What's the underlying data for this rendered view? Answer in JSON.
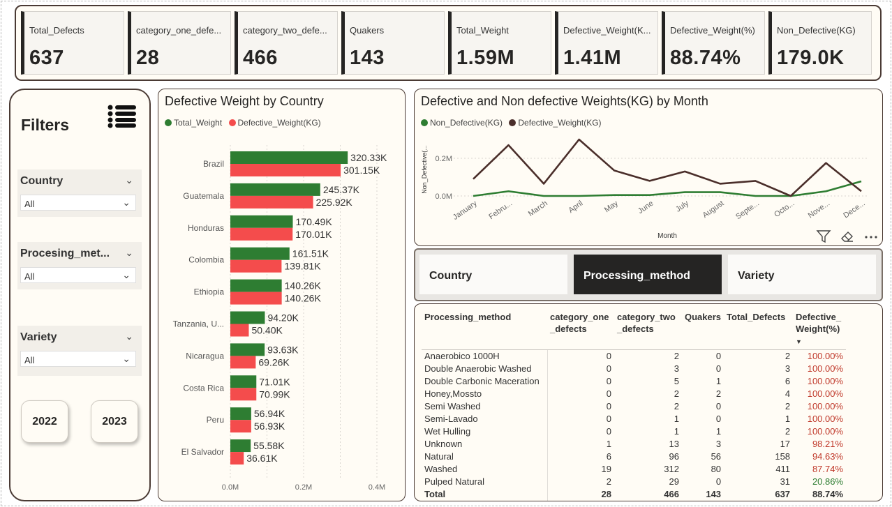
{
  "kpis": [
    {
      "label": "Total_Defects",
      "value": "637"
    },
    {
      "label": "category_one_defe...",
      "value": "28"
    },
    {
      "label": "category_two_defe...",
      "value": "466"
    },
    {
      "label": "Quakers",
      "value": "143"
    },
    {
      "label": "Total_Weight",
      "value": "1.59M"
    },
    {
      "label": "Defective_Weight(K...",
      "value": "1.41M"
    },
    {
      "label": "Defective_Weight(%)",
      "value": "88.74%"
    },
    {
      "label": "Non_Defective(KG)",
      "value": "179.0K"
    }
  ],
  "filters": {
    "title": "Filters",
    "icon": "list-icon",
    "slicers": [
      {
        "label": "Country",
        "value": "All"
      },
      {
        "label": "Procesing_met...",
        "value": "All"
      },
      {
        "label": "Variety",
        "value": "All"
      }
    ],
    "years": [
      "2022",
      "2023"
    ]
  },
  "bar_chart": {
    "title": "Defective Weight by Country",
    "legend": [
      {
        "name": "Total_Weight",
        "color": "#2e7d32"
      },
      {
        "name": "Defective_Weight(KG)",
        "color": "#f44c4c"
      }
    ]
  },
  "line_chart": {
    "title": "Defective and Non defective Weights(KG) by Month",
    "legend": [
      {
        "name": "Non_Defective(KG)",
        "color": "#2e7d32"
      },
      {
        "name": "Defective_Weight(KG)",
        "color": "#4a2e2a"
      }
    ],
    "ylabel": "Non_Defective(...",
    "xlabel": "Month",
    "toolbar_icons": [
      "filter-icon",
      "eraser-icon",
      "more-icon"
    ]
  },
  "chart_data": [
    {
      "type": "bar",
      "title": "Defective Weight by Country",
      "categories": [
        "Brazil",
        "Guatemala",
        "Honduras",
        "Colombia",
        "Ethiopia",
        "Tanzania, U...",
        "Nicaragua",
        "Costa Rica",
        "Peru",
        "El Salvador"
      ],
      "series": [
        {
          "name": "Total_Weight",
          "values": [
            320330,
            245370,
            170490,
            161510,
            140260,
            94200,
            93630,
            71010,
            56940,
            55580
          ],
          "labels": [
            "320.33K",
            "245.37K",
            "170.49K",
            "161.51K",
            "140.26K",
            "94.20K",
            "93.63K",
            "71.01K",
            "56.94K",
            "55.58K"
          ]
        },
        {
          "name": "Defective_Weight(KG)",
          "values": [
            301150,
            225920,
            170010,
            139810,
            140260,
            50400,
            69260,
            70990,
            56930,
            36610
          ],
          "labels": [
            "301.15K",
            "225.92K",
            "170.01K",
            "139.81K",
            "140.26K",
            "50.40K",
            "69.26K",
            "70.99K",
            "56.93K",
            "36.61K"
          ]
        }
      ],
      "xlim": [
        0,
        400000
      ],
      "xticks": [
        "0.0M",
        "0.2M",
        "0.4M"
      ],
      "orientation": "horizontal",
      "grid": true,
      "legend_position": "top-left"
    },
    {
      "type": "line",
      "title": "Defective and Non defective Weights(KG) by Month",
      "x": [
        "January",
        "Febru...",
        "March",
        "April",
        "May",
        "June",
        "July",
        "August",
        "Septe...",
        "Octo...",
        "Nove...",
        "Dece..."
      ],
      "series": [
        {
          "name": "Non_Defective(KG)",
          "values": [
            0,
            25000,
            0,
            0,
            5000,
            5000,
            20000,
            20000,
            0,
            0,
            25000,
            78000
          ]
        },
        {
          "name": "Defective_Weight(KG)",
          "values": [
            90000,
            270000,
            65000,
            300000,
            135000,
            80000,
            130000,
            65000,
            80000,
            0,
            175000,
            25000
          ]
        }
      ],
      "ylim": [
        0,
        300000
      ],
      "yticks": [
        "0.0M",
        "0.2M"
      ],
      "xlabel": "Month",
      "ylabel": "Non_Defective(...",
      "grid": true,
      "legend_position": "top-left"
    }
  ],
  "tabs": [
    {
      "label": "Country",
      "active": false
    },
    {
      "label": "Processing_method",
      "active": true
    },
    {
      "label": "Variety",
      "active": false
    }
  ],
  "table": {
    "headers": [
      "Processing_method",
      "category_one\n_defects",
      "category_two\n_defects",
      "Quakers",
      "Total_Defects",
      "Defective_\nWeight(%)"
    ],
    "sort_indicator": "▼",
    "rows": [
      [
        "Anaerobico 1000H",
        "0",
        "2",
        "0",
        "2",
        "100.00%"
      ],
      [
        "Double Anaerobic Washed",
        "0",
        "3",
        "0",
        "3",
        "100.00%"
      ],
      [
        "Double Carbonic Maceration",
        "0",
        "5",
        "1",
        "6",
        "100.00%"
      ],
      [
        "Honey,Mossto",
        "0",
        "2",
        "2",
        "4",
        "100.00%"
      ],
      [
        "Semi Washed",
        "0",
        "2",
        "0",
        "2",
        "100.00%"
      ],
      [
        "Semi-Lavado",
        "0",
        "1",
        "0",
        "1",
        "100.00%"
      ],
      [
        "Wet Hulling",
        "0",
        "1",
        "1",
        "2",
        "100.00%"
      ],
      [
        "Unknown",
        "1",
        "13",
        "3",
        "17",
        "98.21%"
      ],
      [
        "Natural",
        "6",
        "96",
        "56",
        "158",
        "94.63%"
      ],
      [
        "Washed",
        "19",
        "312",
        "80",
        "411",
        "87.74%"
      ],
      [
        "Pulped Natural",
        "2",
        "29",
        "0",
        "31",
        "20.86%"
      ]
    ],
    "pct_colors": [
      "#c0392b",
      "#c0392b",
      "#c0392b",
      "#c0392b",
      "#c0392b",
      "#c0392b",
      "#c0392b",
      "#c0392b",
      "#c0392b",
      "#c0392b",
      "#2e7d32"
    ],
    "total": [
      "Total",
      "28",
      "466",
      "143",
      "637",
      "88.74%"
    ]
  }
}
